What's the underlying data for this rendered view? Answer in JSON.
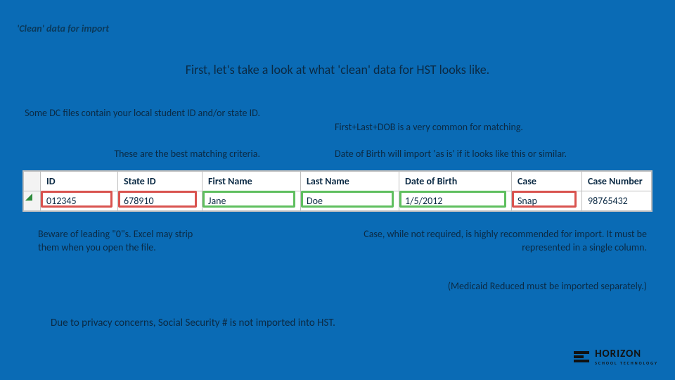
{
  "title": "'Clean' data for import",
  "intro": "First, let's take a look at what 'clean' data for HST looks like.",
  "annotations": {
    "topLeft1": "Some DC files contain your local student ID and/or state ID.",
    "topLeft2": "These are the best matching criteria.",
    "topRight1": "First+Last+DOB is a very common for matching.",
    "topRight2": "Date of Birth will import 'as is' if it looks like this or similar.",
    "bottomLeft": "Beware of leading \"0\"s. Excel may strip them when you open the file.",
    "bottomRight": "Case, while not required, is highly recommended for import. It must be represented in a single column.",
    "medicaid": "(Medicaid Reduced must be imported separately.)",
    "privacy": "Due to privacy concerns, Social Security # is not imported into HST."
  },
  "table": {
    "headers": [
      "ID",
      "State ID",
      "First Name",
      "Last Name",
      "Date of Birth",
      "Case",
      "Case Number"
    ],
    "row": [
      "012345",
      "678910",
      "Jane",
      "Doe",
      "1/5/2012",
      "Snap",
      "98765432"
    ]
  },
  "logo": {
    "brand": "HORIZON",
    "sub": "SCHOOL TECHNOLOGY"
  }
}
